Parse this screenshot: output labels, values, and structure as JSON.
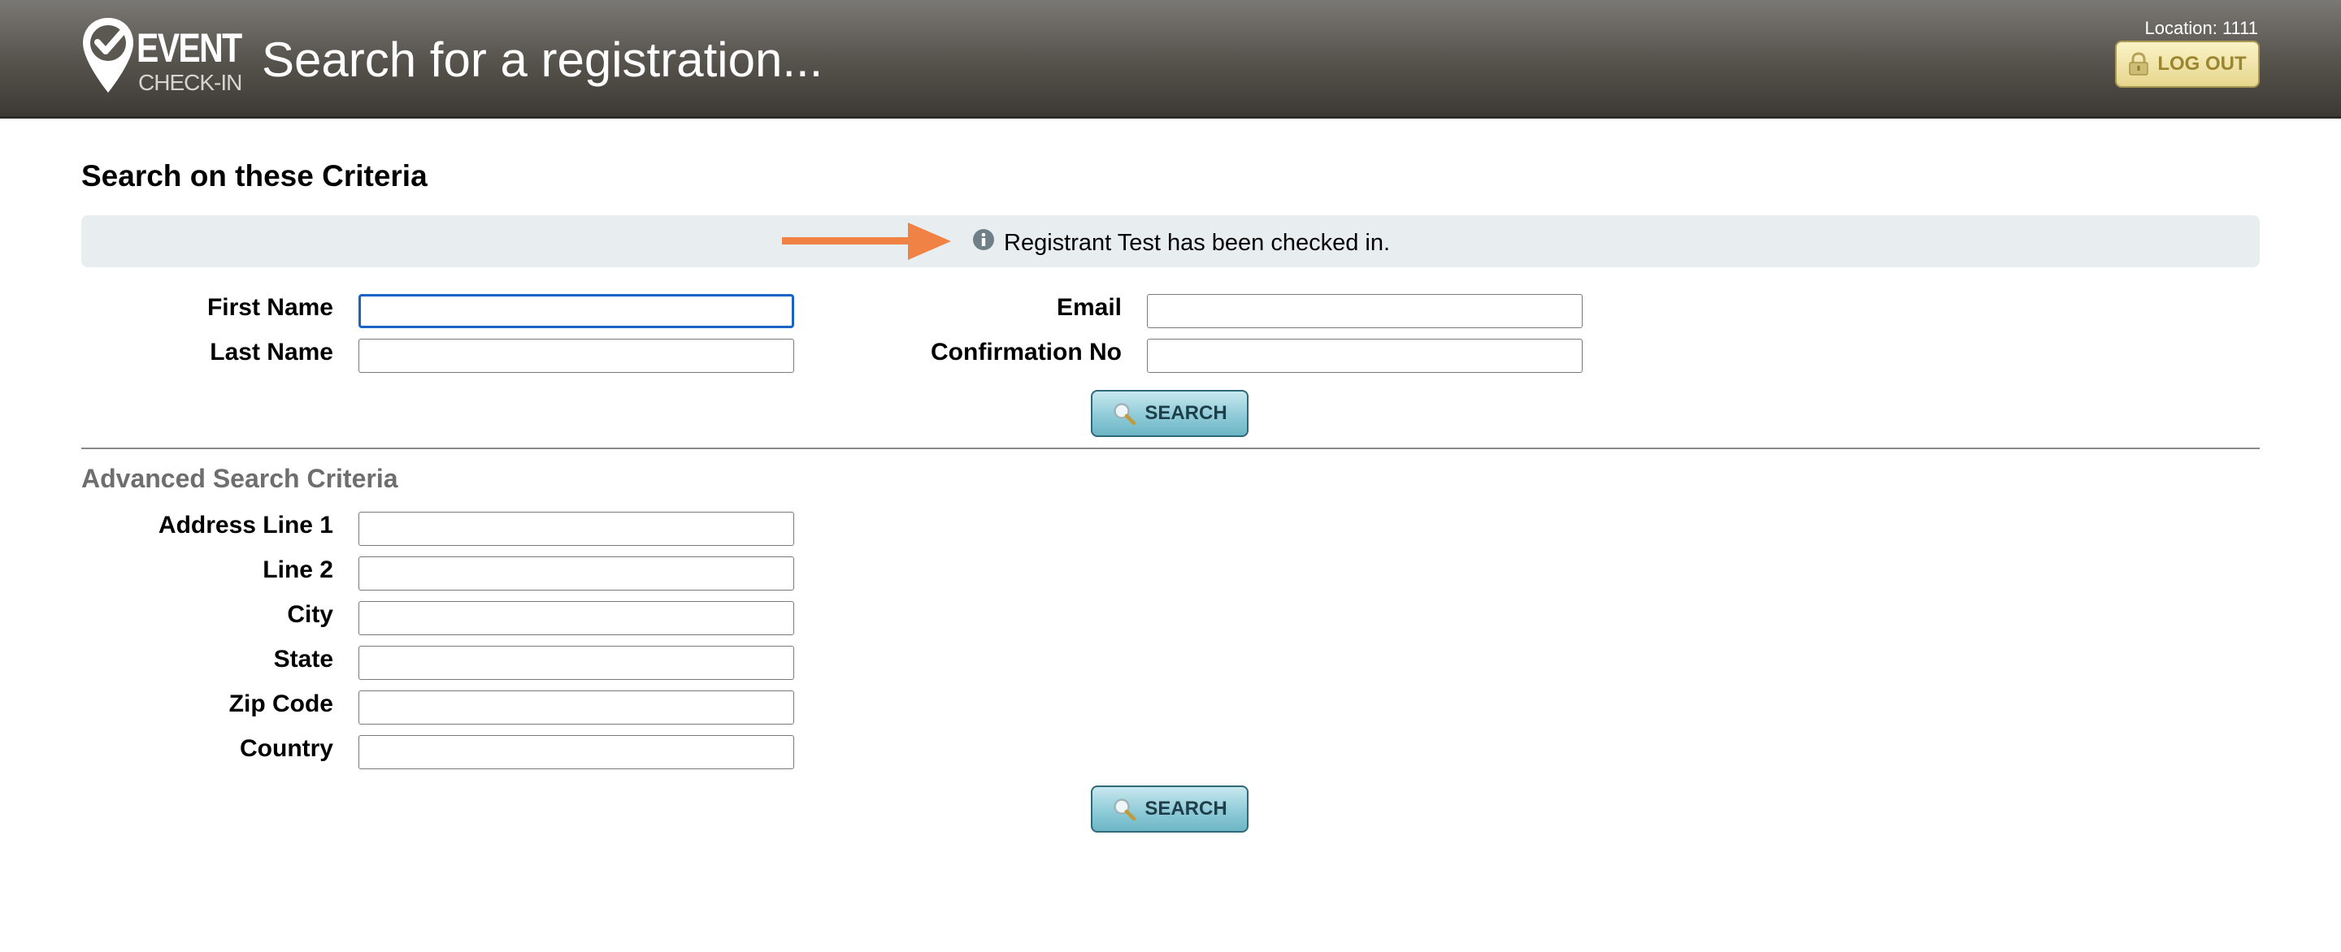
{
  "header": {
    "logo_event": "EVENT",
    "logo_checkin": "CHECK-IN",
    "title": "Search for a registration...",
    "location": "Location: 1111",
    "logout_label": "LOG OUT"
  },
  "main": {
    "section_title": "Search on these Criteria",
    "notice": {
      "icon": "info-icon",
      "text": "Registrant Test has been checked in."
    },
    "basic_fields": {
      "first_name_label": "First Name",
      "last_name_label": "Last Name",
      "email_label": "Email",
      "confirmation_label": "Confirmation No",
      "first_name_value": "",
      "last_name_value": "",
      "email_value": "",
      "confirmation_value": ""
    },
    "search_label": "SEARCH",
    "advanced_title": "Advanced Search Criteria",
    "advanced_fields": {
      "address1_label": "Address Line 1",
      "line2_label": "Line 2",
      "city_label": "City",
      "state_label": "State",
      "zip_label": "Zip Code",
      "country_label": "Country",
      "address1_value": "",
      "line2_value": "",
      "city_value": "",
      "state_value": "",
      "zip_value": "",
      "country_value": ""
    }
  },
  "colors": {
    "header_bg": "#55524c",
    "focus_border": "#1a63c6",
    "arrow": "#f08246",
    "search_button": "#8fcbd8",
    "logout_button": "#e6d68d"
  }
}
